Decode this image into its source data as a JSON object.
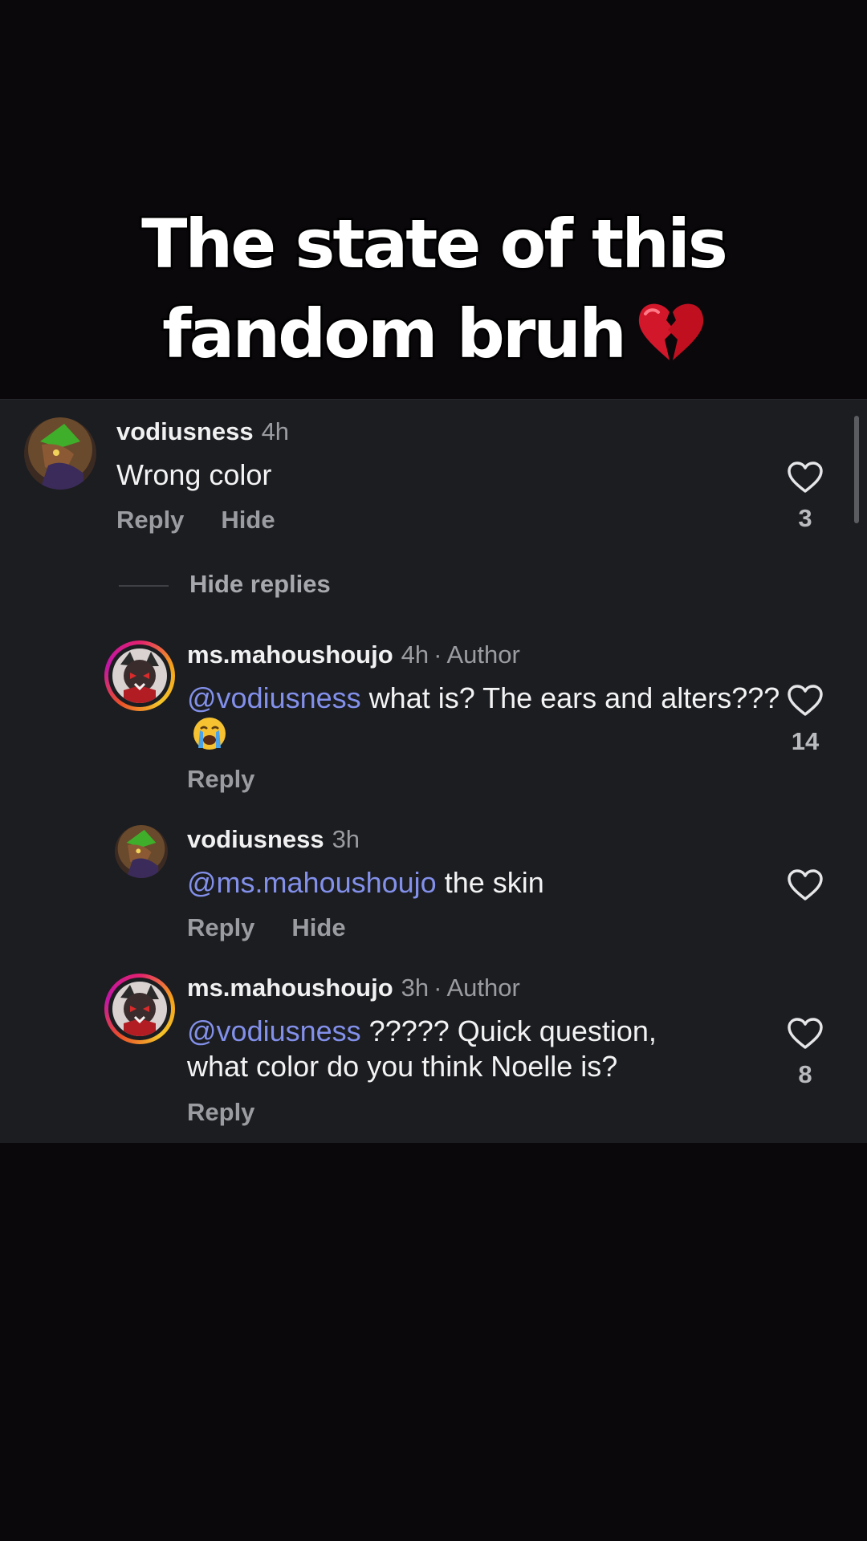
{
  "caption": {
    "line1": "The state of this",
    "line2": "fandom bruh"
  },
  "comments": [
    {
      "username": "vodiusness",
      "time": "4h",
      "text": "Wrong color",
      "reply_label": "Reply",
      "hide_label": "Hide",
      "likes": "3"
    }
  ],
  "hide_replies_label": "Hide replies",
  "replies": [
    {
      "username": "ms.mahoushoujo",
      "time": "4h",
      "separator": "·",
      "author_badge": "Author",
      "mention": "@vodiusness",
      "text": "what is? The ears and alters???",
      "reply_label": "Reply",
      "likes": "14"
    },
    {
      "username": "vodiusness",
      "time": "3h",
      "mention": "@ms.mahoushoujo",
      "text": "the skin",
      "reply_label": "Reply",
      "hide_label": "Hide",
      "likes": ""
    },
    {
      "username": "ms.mahoushoujo",
      "time": "3h",
      "separator": "·",
      "author_badge": "Author",
      "mention": "@vodiusness",
      "text_line1": "????? Quick question,",
      "text_line2": "what color do you think Noelle is?",
      "reply_label": "Reply",
      "likes": "8"
    }
  ],
  "icons": {
    "like": "heart-outline-icon",
    "caption_emoji": "broken-heart-icon",
    "reply_emoji": "crying-face-icon"
  },
  "colors": {
    "background": "#0b080c",
    "panel": "#1b1d21",
    "mention": "#8390ea",
    "muted": "#9a9ca1"
  }
}
